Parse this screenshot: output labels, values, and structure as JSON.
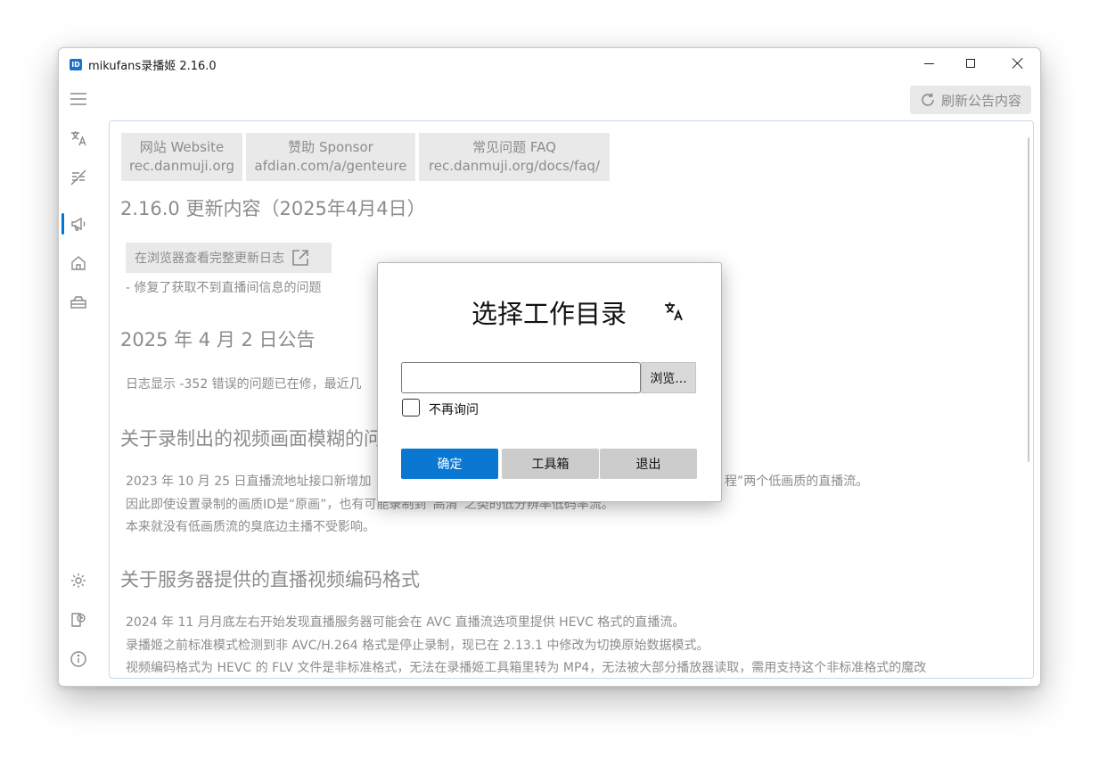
{
  "window": {
    "title": "mikufans录播姬 2.16.0",
    "app_icon_text": "ID"
  },
  "sidebar": {
    "items": [
      {
        "icon": "hamburger-menu-icon"
      },
      {
        "icon": "translate-icon"
      },
      {
        "icon": "danmaku-off-icon"
      },
      {
        "icon": "announcement-icon",
        "active": true
      },
      {
        "icon": "home-icon"
      },
      {
        "icon": "toolbox-icon"
      },
      {
        "icon": "settings-gear-icon"
      },
      {
        "icon": "log-icon"
      },
      {
        "icon": "info-icon"
      }
    ]
  },
  "toolbar": {
    "refresh_label": "刷新公告内容"
  },
  "content": {
    "links": [
      {
        "line1": "网站 Website",
        "line2": "rec.danmuji.org"
      },
      {
        "line1": "赞助 Sponsor",
        "line2": "afdian.com/a/genteure"
      },
      {
        "line1": "常见问题 FAQ",
        "line2": "rec.danmuji.org/docs/faq/"
      }
    ],
    "update_heading": "2.16.0 更新内容（2025年4月4日）",
    "changelog_button": "在浏览器查看完整更新日志",
    "update_item": "- 修复了获取不到直播间信息的问题",
    "announcement_heading": "2025 年 4 月 2 日公告",
    "announcement_text": "日志显示 -352 错误的问题已在修，最近几",
    "blur_heading": "关于录制出的视频画面模糊的问",
    "blur_p1": "2023 年 10 月 25 日直播流地址接口新增加",
    "blur_p1_tail": "程”两个低画质的直播流。",
    "blur_p2": "因此即使设置录制的画质ID是“原画”，也有可能录制到“高清”之类的低分辨率低码率流。",
    "blur_p3": "本来就没有低画质流的臭底边主播不受影响。",
    "codec_heading": "关于服务器提供的直播视频编码格式",
    "codec_p1": "2024 年 11 月月底左右开始发现直播服务器可能会在 AVC 直播流选项里提供 HEVC 格式的直播流。",
    "codec_p2": "录播姬之前标准模式检测到非 AVC/H.264 格式是停止录制，现已在 2.13.1 中修改为切换原始数据模式。",
    "codec_p3": "视频编码格式为 HEVC 的 FLV 文件是非标准格式，无法在录播姬工具箱里转为 MP4，无法被大部分播放器读取，需用支持这个非标准格式的魔改"
  },
  "dialog": {
    "title": "选择工作目录",
    "path_value": "",
    "path_placeholder": "",
    "browse_label": "浏览...",
    "dont_ask_label": "不再询问",
    "dont_ask_checked": false,
    "ok_label": "确定",
    "tools_label": "工具箱",
    "exit_label": "退出",
    "accent_color": "#0a78d2"
  }
}
